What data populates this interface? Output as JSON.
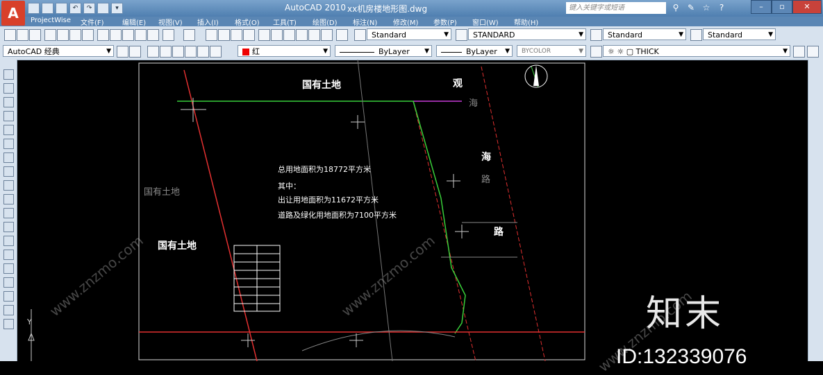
{
  "window": {
    "app_title": "AutoCAD 2010",
    "file_name": "xx机房楼地形图.dwg",
    "search_placeholder": "键入关键字或短语",
    "app_letter": "A"
  },
  "menu": [
    "ProjectWise",
    "文件(F)",
    "编辑(E)",
    "视图(V)",
    "插入(I)",
    "格式(O)",
    "工具(T)",
    "绘图(D)",
    "标注(N)",
    "修改(M)",
    "参数(P)",
    "窗口(W)",
    "帮助(H)"
  ],
  "toolbar1": {
    "text_style": "Standard",
    "dim_style": "STANDARD",
    "table_style": "Standard",
    "mleader_style": "Standard"
  },
  "toolbar2": {
    "workspace": "AutoCAD 经典",
    "color": "红",
    "linetype": "ByLayer",
    "lineweight": "ByLayer",
    "plotstyle": "BYCOLOR",
    "layer": "THICK"
  },
  "drawing": {
    "land_top": "国有土地",
    "land_left_gray": "国有土地",
    "land_left": "国有土地",
    "road_char_1": "观",
    "road_char_2": "海",
    "road_char_3": "海",
    "road_char_4": "路",
    "road_char_5": "路",
    "note_total": "总用地面积为18772平方米",
    "note_among": "其中：",
    "note_transfer": "出让用地面积为11672平方米",
    "note_road": "道路及绿化用地面积为7100平方米",
    "ucs_y": "Y"
  },
  "colors": {
    "titlebar": "#5a86b4",
    "toolbar": "#d7e2ee",
    "canvas": "#000000",
    "boundary_red": "#e33030",
    "boundary_green": "#39d03a",
    "magenta": "#c83ad8"
  },
  "watermark": {
    "brand": "知末",
    "id": "ID:132339076",
    "site": "www.znzmo.com"
  }
}
